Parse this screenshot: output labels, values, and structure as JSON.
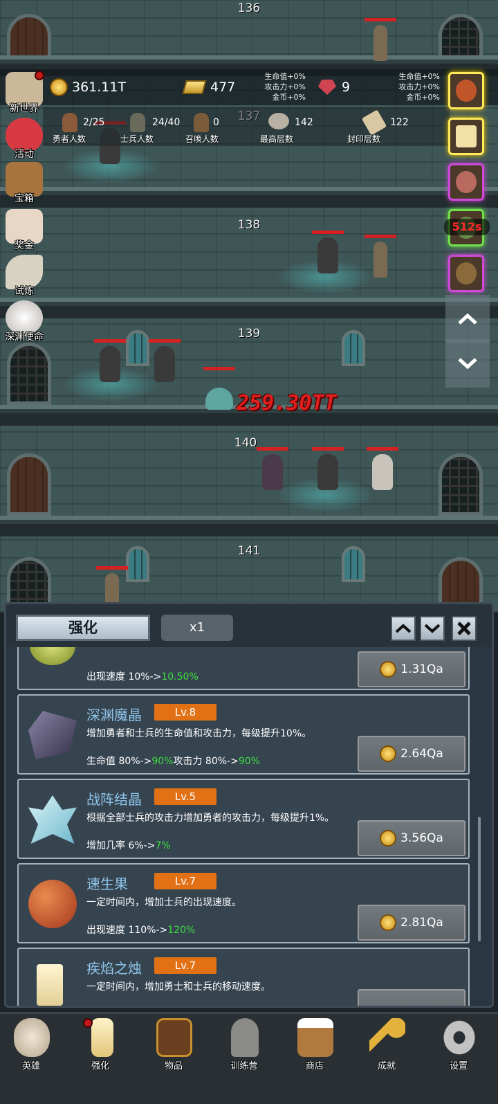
{
  "floors": [
    {
      "number": "136"
    },
    {
      "number": "137"
    },
    {
      "number": "138"
    },
    {
      "number": "139"
    },
    {
      "number": "140"
    },
    {
      "number": "141"
    }
  ],
  "damage_popup": "259.30TT",
  "resources": {
    "coins": "361.11T",
    "gold_bars": "477",
    "gems": "9",
    "bonus_left": {
      "hp": "生命值+0%",
      "atk": "攻击力+0%",
      "gold": "金币+0%"
    },
    "bonus_right": {
      "hp": "生命值+0%",
      "atk": "攻击力+0%",
      "gold": "金币+0%"
    }
  },
  "stats": [
    {
      "value": "2/25",
      "label": "勇者人数"
    },
    {
      "value": "24/40",
      "label": "士兵人数"
    },
    {
      "value": "0",
      "label": "召唤人数"
    },
    {
      "value": "142",
      "label": "最高层数"
    },
    {
      "value": "122",
      "label": "封印层数"
    }
  ],
  "left_menu": [
    {
      "label": "新世界"
    },
    {
      "label": "活动"
    },
    {
      "label": "宝箱"
    },
    {
      "label": "奖金"
    },
    {
      "label": "试炼"
    },
    {
      "label": "深渊使命"
    }
  ],
  "buff_timer": "512s",
  "panel": {
    "tab_label": "强化",
    "multiplier": "x1",
    "items": [
      {
        "name": "",
        "level": "",
        "desc": "",
        "effect_prefix": "出现速度 10%->",
        "effect_new": "10.50%",
        "effect_mid": "",
        "effect_new2": "",
        "cost": "1.31Qa"
      },
      {
        "name": "深渊魔晶",
        "level": "Lv.8",
        "desc": "增加勇者和士兵的生命值和攻击力，每级提升10%。",
        "effect_prefix": "生命值 80%->",
        "effect_new": "90%",
        "effect_mid": "攻击力 80%->",
        "effect_new2": "90%",
        "cost": "2.64Qa"
      },
      {
        "name": "战阵结晶",
        "level": "Lv.5",
        "desc": "根据全部士兵的攻击力增加勇者的攻击力，每级提升1%。",
        "effect_prefix": "增加几率 6%->",
        "effect_new": "7%",
        "effect_mid": "",
        "effect_new2": "",
        "cost": "3.56Qa"
      },
      {
        "name": "速生果",
        "level": "Lv.7",
        "desc": "一定时间内，增加士兵的出现速度。",
        "effect_prefix": "出现速度 110%->",
        "effect_new": "120%",
        "effect_mid": "",
        "effect_new2": "",
        "cost": "2.81Qa"
      },
      {
        "name": "疾焰之烛",
        "level": "Lv.7",
        "desc": "一定时间内，增加勇士和士兵的移动速度。",
        "effect_prefix": "",
        "effect_new": "",
        "effect_mid": "",
        "effect_new2": "",
        "cost": ""
      }
    ]
  },
  "bottom_nav": [
    {
      "label": "英雄"
    },
    {
      "label": "强化"
    },
    {
      "label": "物品"
    },
    {
      "label": "训练营"
    },
    {
      "label": "商店"
    },
    {
      "label": "成就"
    },
    {
      "label": "设置"
    }
  ],
  "colors": {
    "accent_level": "#e27115",
    "name_blue": "#8fc5ea",
    "effect_green": "#3ede3e",
    "hp_red": "#d42222"
  }
}
